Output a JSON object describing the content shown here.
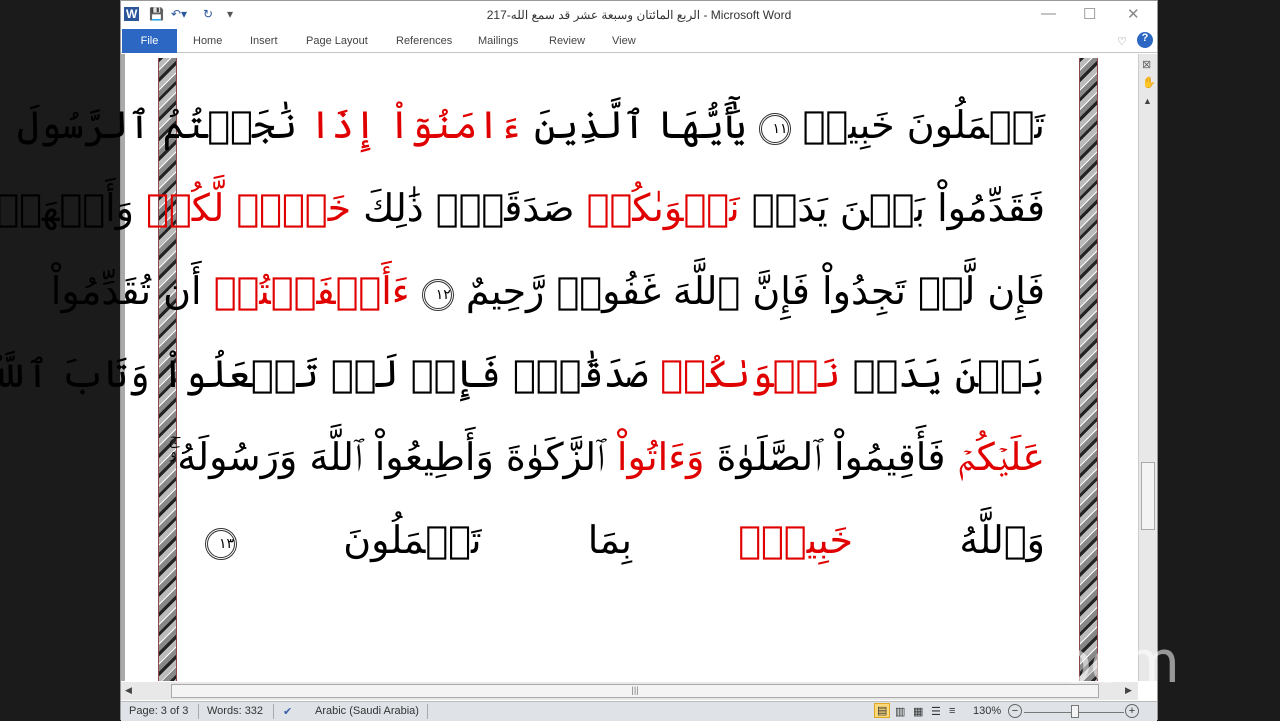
{
  "titlebar": {
    "title": "الربع المائتان وسبعة عشر قد سمع الله-217  -  Microsoft Word",
    "minimize": "—",
    "maximize": "☐",
    "close": "✕"
  },
  "ribbon": {
    "file": "File",
    "tabs": [
      "Home",
      "Insert",
      "Page Layout",
      "References",
      "Mailings",
      "Review",
      "View"
    ]
  },
  "document": {
    "lines": [
      [
        {
          "t": "تَعۡمَلُونَ خَبِيرٞ "
        },
        {
          "aya": "١١"
        },
        {
          "t": " يَٰٓأَيُّهَا ٱلَّذِينَ "
        },
        {
          "t": "ءَامَنُوٓاْ إِذَا",
          "red": true
        },
        {
          "t": " نَٰجَيۡتُمُ ٱلرَّسُولَ"
        }
      ],
      [
        {
          "t": "فَقَدِّمُواْ بَيۡنَ يَدَيۡ "
        },
        {
          "t": "نَجۡوَىٰكُمۡ",
          "red": true
        },
        {
          "t": " صَدَقَةٗۚ ذَٰلِكَ "
        },
        {
          "t": "خَيۡرٞ",
          "red": true
        },
        {
          "t": " "
        },
        {
          "t": "لَّكُمۡ",
          "red": true
        },
        {
          "t": " وَأَطۡهَرُۚ"
        }
      ],
      [
        {
          "t": "فَإِن لَّمۡ تَجِدُواْ فَإِنَّ ٱللَّهَ غَفُورٞ رَّحِيمٌ "
        },
        {
          "aya": "١٢"
        },
        {
          "t": " "
        },
        {
          "t": "ءَأَشۡفَقۡتُمۡ",
          "red": true
        },
        {
          "t": " أَن تُقَدِّمُواْ"
        }
      ],
      [
        {
          "t": "بَيۡنَ يَدَيۡ "
        },
        {
          "t": "نَجۡوَىٰكُمۡ",
          "red": true
        },
        {
          "t": " صَدَقَٰتٖۚ فَإِذۡ لَمۡ تَفۡعَلُواْ وَتَابَ ٱللَّهُ"
        }
      ],
      [
        {
          "t": "عَلَيۡكُمۡ",
          "red": true
        },
        {
          "t": " فَأَقِيمُواْ ٱلصَّلَوٰةَ "
        },
        {
          "t": "وَءَاتُواْ",
          "red": true
        },
        {
          "t": " ٱلزَّكَوٰةَ وَأَطِيعُواْ ٱللَّهَ وَرَسُولَهُۥۚ"
        }
      ],
      [
        {
          "t": "وَٱللَّهُ "
        },
        {
          "t": "خَبِيرُۢ",
          "red": true
        },
        {
          "t": " بِمَا تَعۡمَلُونَ "
        },
        {
          "aya": "١٣"
        }
      ]
    ]
  },
  "status": {
    "page": "Page: 3 of 3",
    "words": "Words: 332",
    "language": "Arabic (Saudi Arabia)",
    "zoom": "130%",
    "zoom_minus": "−",
    "zoom_plus": "+"
  },
  "overlay": {
    "logo": "zoom"
  }
}
